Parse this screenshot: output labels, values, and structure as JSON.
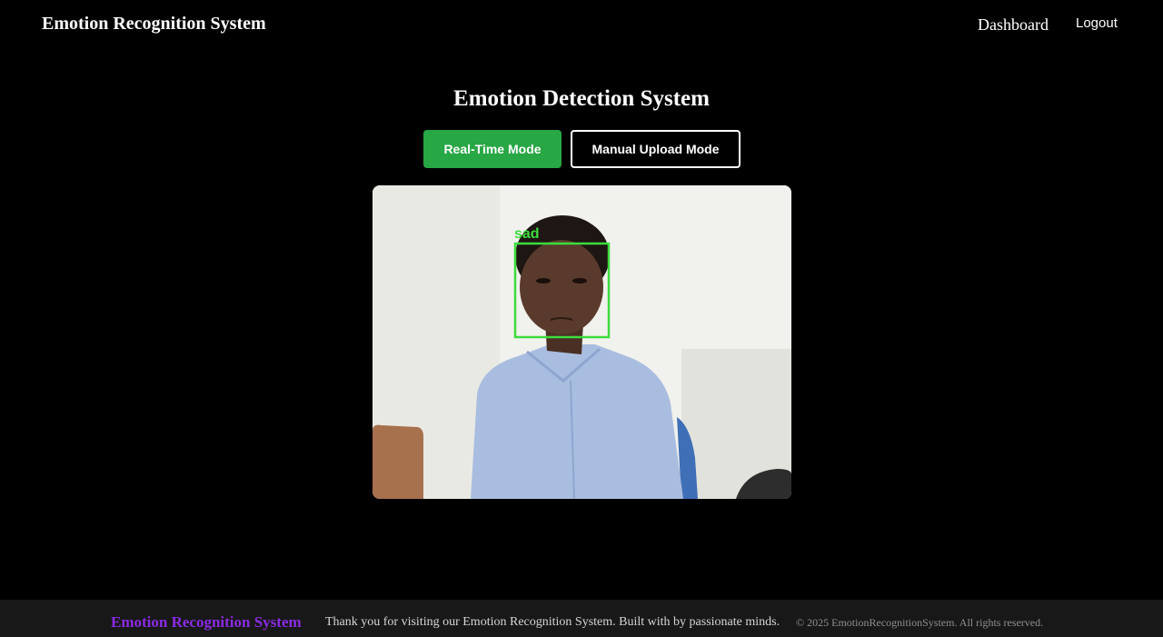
{
  "navbar": {
    "brand": "Emotion Recognition System",
    "links": {
      "dashboard": "Dashboard",
      "logout": "Logout"
    }
  },
  "main": {
    "title": "Emotion Detection System",
    "modes": {
      "realtime_label": "Real-Time Mode",
      "manual_label": "Manual Upload Mode",
      "active": "Real-Time Mode"
    },
    "video": {
      "detected_emotion": "sad",
      "box_color": "#3ddc3d"
    }
  },
  "footer": {
    "brand": "Emotion Recognition System",
    "message": "Thank you for visiting our Emotion Recognition System. Built with by passionate minds.",
    "copyright": "© 2025 EmotionRecognitionSystem. All rights reserved."
  },
  "colors": {
    "background": "#000000",
    "primary_button": "#28a745",
    "footer_brand": "#8a2be2",
    "footer_background": "#181818"
  }
}
